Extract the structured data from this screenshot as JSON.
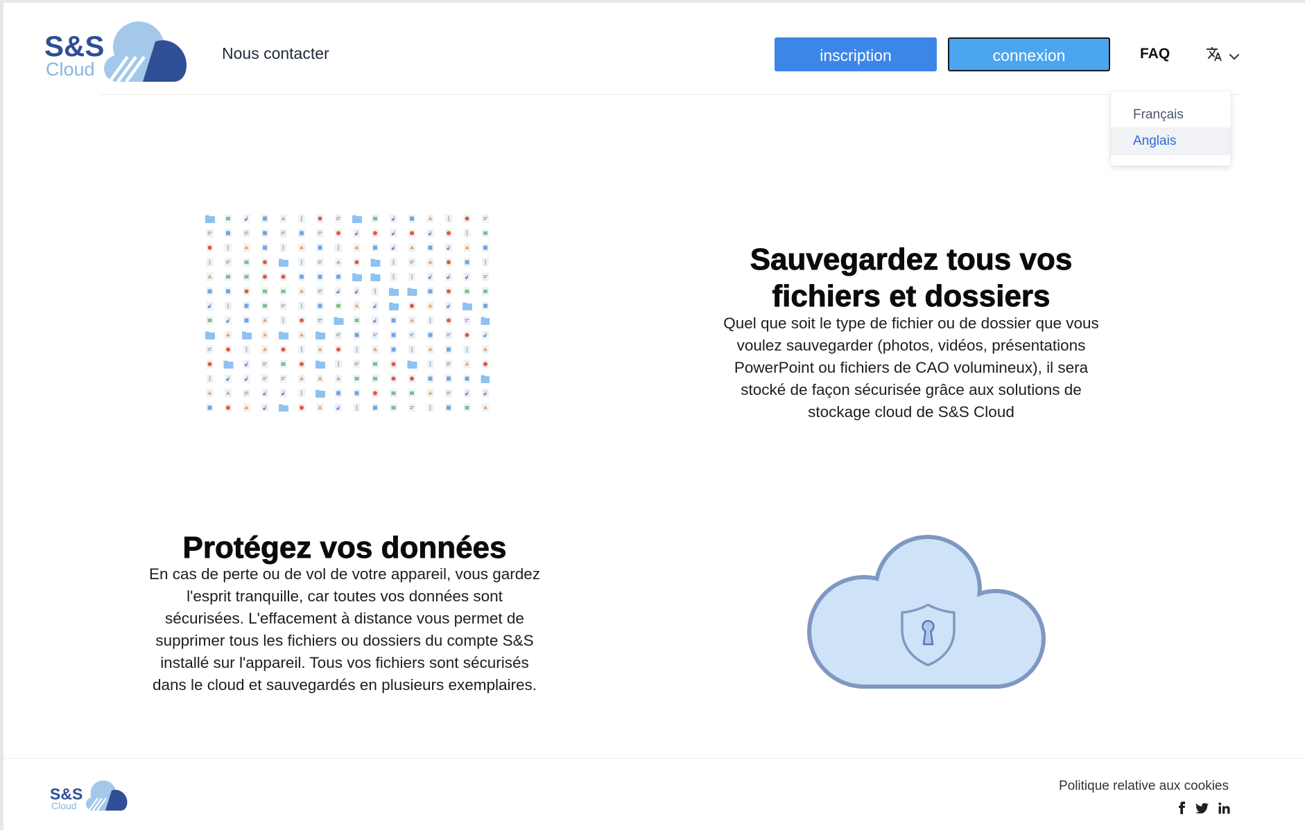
{
  "colors": {
    "signup_button": "#3c86e8",
    "login_button": "#4ca5ef",
    "brand_dark": "#2f4f96",
    "brand_light": "#a3c8ea",
    "brand_text_light": "#86b5e0",
    "active_option": "#2d6bd4",
    "illustration_fill": "#cfe3f8",
    "illustration_stroke": "#7f98c3"
  },
  "header": {
    "logo": {
      "brand": "S&S",
      "sub": "Cloud",
      "icon": "cloud-logo-icon"
    },
    "contact_link": "Nous contacter",
    "signup_label": "inscription",
    "login_label": "connexion",
    "faq_label": "FAQ",
    "language_icon": "translate-icon",
    "language_menu": {
      "options": [
        "Français",
        "Anglais"
      ],
      "highlighted": "Anglais"
    }
  },
  "sections": [
    {
      "title_lines": [
        "Sauvegardez tous vos",
        "fichiers et dossiers"
      ],
      "body_lines": [
        "Quel que soit le type de fichier ou de dossier que vous",
        "voulez sauvegarder (photos, vidéos, présentations",
        "PowerPoint ou fichiers de CAO volumineux), il sera",
        "stocké de façon sécurisée grâce aux solutions de",
        "stockage cloud de S&S Cloud"
      ],
      "file_icon_types": [
        {
          "name": "folder-icon",
          "color": "#8ec2f2"
        },
        {
          "name": "document-icon",
          "color": "#6ea6e6"
        },
        {
          "name": "pdf-icon",
          "color": "#e5573a"
        },
        {
          "name": "image-icon",
          "color": "#7bc47f"
        },
        {
          "name": "presentation-icon",
          "color": "#f2a04e"
        },
        {
          "name": "text-file-icon",
          "color": "#8c96a3"
        },
        {
          "name": "audio-icon",
          "color": "#6b8fc7"
        },
        {
          "name": "archive-icon",
          "color": "#b9c1ca"
        }
      ]
    },
    {
      "title_lines": [
        "Protégez vos données"
      ],
      "body_lines": [
        "En cas de perte ou de vol de votre appareil, vous gardez",
        "l'esprit tranquille, car toutes vos données sont",
        "sécurisées. L'effacement à distance vous permet de",
        "supprimer tous les fichiers ou dossiers du compte S&S",
        "installé sur l'appareil. Tous vos fichiers sont sécurisés",
        "dans le cloud et sauvegardés en plusieurs exemplaires."
      ]
    }
  ],
  "footer": {
    "logo": {
      "brand": "S&S",
      "sub": "Cloud"
    },
    "cookie_link": "Politique relative aux cookies",
    "social": [
      {
        "icon": "facebook-icon"
      },
      {
        "icon": "twitter-icon"
      },
      {
        "icon": "linkedin-icon"
      }
    ]
  }
}
